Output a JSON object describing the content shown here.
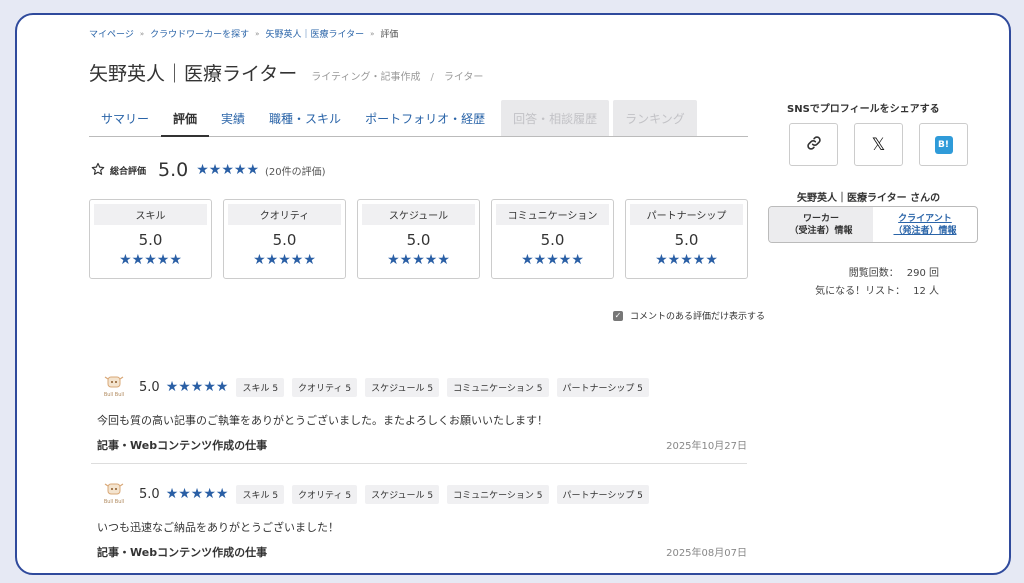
{
  "breadcrumb": {
    "items": [
      "マイページ",
      "クラウドワーカーを探す",
      "矢野英人｜医療ライター"
    ],
    "current": "評価",
    "separator": "»"
  },
  "profile": {
    "name": "矢野英人｜医療ライター",
    "category": "ライティング・記事作成",
    "slash": "/",
    "subcategory": "ライター"
  },
  "tabs": [
    {
      "label": "サマリー",
      "state": "normal"
    },
    {
      "label": "評価",
      "state": "active"
    },
    {
      "label": "実績",
      "state": "normal"
    },
    {
      "label": "職種・スキル",
      "state": "normal"
    },
    {
      "label": "ポートフォリオ・経歴",
      "state": "normal"
    },
    {
      "label": "回答・相談履歴",
      "state": "disabled"
    },
    {
      "label": "ランキング",
      "state": "disabled"
    }
  ],
  "overall": {
    "icon": "star-outline-icon",
    "label": "総合評価",
    "score": "5.0",
    "stars": "★★★★★",
    "count": "(20件の評価)"
  },
  "categories": [
    {
      "name": "スキル",
      "score": "5.0",
      "stars": "★★★★★"
    },
    {
      "name": "クオリティ",
      "score": "5.0",
      "stars": "★★★★★"
    },
    {
      "name": "スケジュール",
      "score": "5.0",
      "stars": "★★★★★"
    },
    {
      "name": "コミュニケーション",
      "score": "5.0",
      "stars": "★★★★★"
    },
    {
      "name": "パートナーシップ",
      "score": "5.0",
      "stars": "★★★★★"
    }
  ],
  "filter": {
    "label": "コメントのある評価だけ表示する",
    "checked": true,
    "check_mark": "✓"
  },
  "reviews": [
    {
      "avatar_text": "Bull Bull",
      "score": "5.0",
      "stars": "★★★★★",
      "badges": [
        "スキル 5",
        "クオリティ 5",
        "スケジュール 5",
        "コミュニケーション 5",
        "パートナーシップ 5"
      ],
      "comment": "今回も質の高い記事のご執筆をありがとうございました。またよろしくお願いいたします！",
      "job": "記事・Webコンテンツ作成の仕事",
      "date": "2025年10月27日"
    },
    {
      "avatar_text": "Bull Bull",
      "score": "5.0",
      "stars": "★★★★★",
      "badges": [
        "スキル 5",
        "クオリティ 5",
        "スケジュール 5",
        "コミュニケーション 5",
        "パートナーシップ 5"
      ],
      "comment": "いつも迅速なご納品をありがとうございました！",
      "job": "記事・Webコンテンツ作成の仕事",
      "date": "2025年08月07日"
    }
  ],
  "sidebar": {
    "sns_title": "SNSでプロフィールをシェアする",
    "sns_buttons": [
      {
        "icon": "link-icon"
      },
      {
        "icon": "x-logo-icon",
        "glyph": "𝕏"
      },
      {
        "icon": "hatena-bookmark-icon",
        "glyph": "B!"
      }
    ],
    "name_label": "矢野英人｜医療ライター さんの",
    "roles": [
      {
        "line1": "ワーカー",
        "line2": "（受注者）情報",
        "state": "active"
      },
      {
        "line1": "クライアント",
        "line2": "（発注者）情報",
        "state": "link"
      }
    ],
    "stats": [
      {
        "label": "閲覧回数：",
        "value": "290 回"
      },
      {
        "label": "気になる！リスト：",
        "value": "12 人"
      }
    ]
  },
  "colors": {
    "accent": "#2a64a8",
    "star": "#2a5fa5",
    "frame": "#2f4a9c",
    "hatena": "#2f9bd9"
  }
}
